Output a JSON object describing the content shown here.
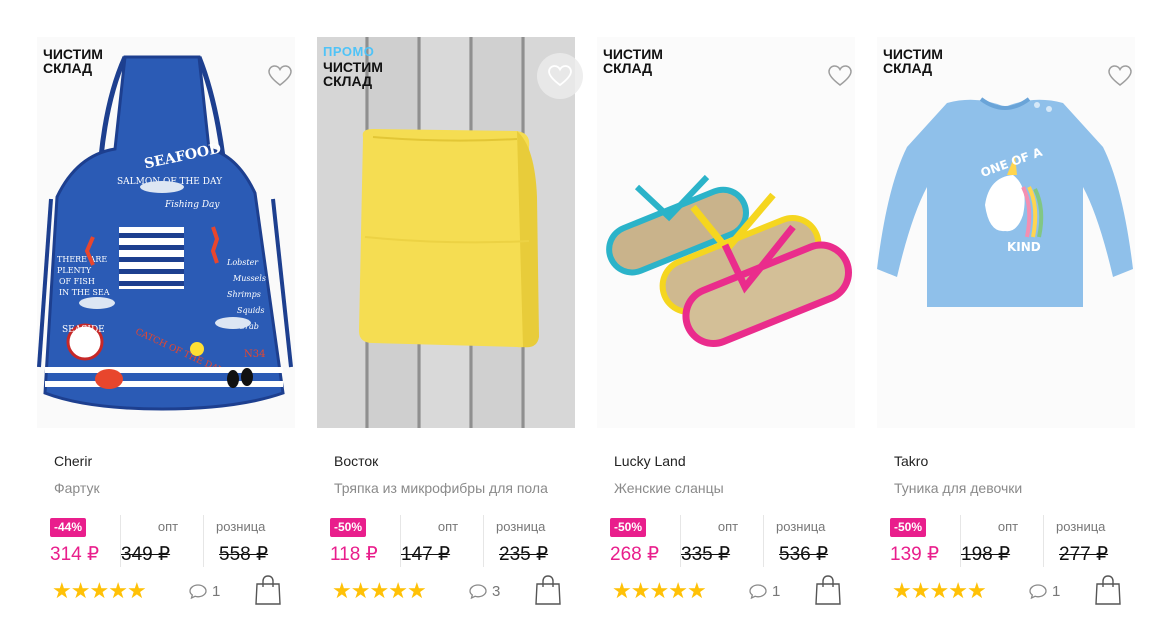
{
  "products": [
    {
      "promo": "",
      "badge": "ЧИСТИМ СКЛАД",
      "brand": "Cherir",
      "title": "Фартук",
      "discount": "-44%",
      "price": "314 ₽",
      "opt_label": "опт",
      "opt_price": "349 ₽",
      "retail_label": "розница",
      "retail_price": "558 ₽",
      "rating": 5,
      "comments": "1",
      "image": "apron",
      "favorite_hover": false
    },
    {
      "promo": "ПРОМО",
      "badge": "ЧИСТИМ СКЛАД",
      "brand": "Восток",
      "title": "Тряпка из микрофибры для пола",
      "discount": "-50%",
      "price": "118 ₽",
      "opt_label": "опт",
      "opt_price": "147 ₽",
      "retail_label": "розница",
      "retail_price": "235 ₽",
      "rating": 5,
      "comments": "3",
      "image": "microfiber-cloth",
      "favorite_hover": true
    },
    {
      "promo": "",
      "badge": "ЧИСТИМ СКЛАД",
      "brand": "Lucky Land",
      "title": "Женские сланцы",
      "discount": "-50%",
      "price": "268 ₽",
      "opt_label": "опт",
      "opt_price": "335 ₽",
      "retail_label": "розница",
      "retail_price": "536 ₽",
      "rating": 5,
      "comments": "1",
      "image": "flip-flops",
      "favorite_hover": false
    },
    {
      "promo": "",
      "badge": "ЧИСТИМ СКЛАД",
      "brand": "Takro",
      "title": "Туника для девочки",
      "discount": "-50%",
      "price": "139 ₽",
      "opt_label": "опт",
      "opt_price": "198 ₽",
      "retail_label": "розница",
      "retail_price": "277 ₽",
      "rating": 5,
      "comments": "1",
      "image": "tunic",
      "favorite_hover": false
    }
  ],
  "icons": {
    "favorite": "heart-outline-icon",
    "comments": "speech-bubble-icon",
    "cart": "shopping-bag-icon",
    "rating": "star-icon"
  },
  "colors": {
    "accent": "#e91e8c",
    "promo": "#4fc3f7",
    "star": "#ffc107"
  }
}
